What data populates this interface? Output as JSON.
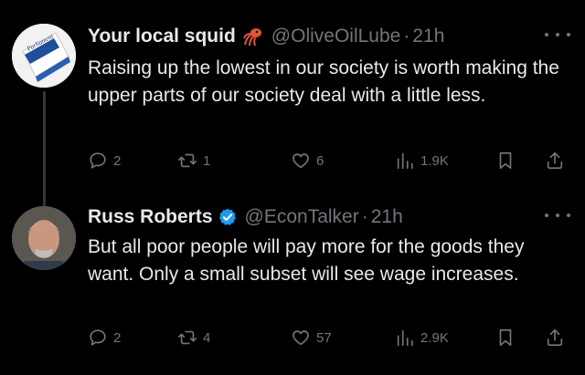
{
  "tweets": [
    {
      "display_name": "Your local squid",
      "emoji_icon": "squid-emoji",
      "handle": "@OliveOilLube",
      "separator": "·",
      "time": "21h",
      "text": "Raising up the lowest in our society is worth making the upper parts of our society deal with a little less.",
      "avatar_text": "Parliament",
      "replies": "2",
      "retweets": "1",
      "likes": "6",
      "views": "1.9K"
    },
    {
      "display_name": "Russ Roberts",
      "verified_icon": "verified-badge-icon",
      "handle": "@EconTalker",
      "separator": "·",
      "time": "21h",
      "text": "But all poor people will pay more for the goods they want. Only a small subset will see wage increases.",
      "replies": "2",
      "retweets": "4",
      "likes": "57",
      "views": "2.9K"
    }
  ],
  "colors": {
    "background": "#000000",
    "text": "#e7e9ea",
    "muted": "#71767b",
    "verified": "#1d9bf0",
    "thread_line": "#333639"
  }
}
